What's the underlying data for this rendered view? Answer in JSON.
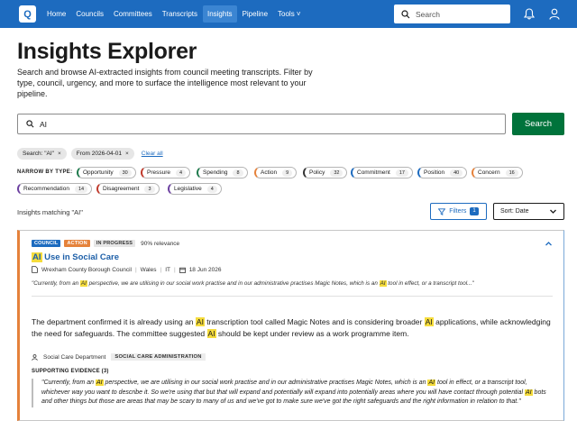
{
  "nav": {
    "logo": "Q",
    "items": [
      {
        "label": "Home"
      },
      {
        "label": "Councils"
      },
      {
        "label": "Committees"
      },
      {
        "label": "Transcripts"
      },
      {
        "label": "Insights"
      },
      {
        "label": "Pipeline"
      },
      {
        "label": "Tools ˅"
      }
    ],
    "active": "Insights",
    "search_placeholder": "Search"
  },
  "page": {
    "title": "Insights Explorer",
    "intro": "Search and browse AI-extracted insights from council meeting transcripts. Filter by type, council, urgency, and more to surface the intelligence most relevant to your pipeline."
  },
  "search": {
    "query": "AI",
    "button": "Search"
  },
  "active_filters": {
    "chips": [
      {
        "label": "Search: \"AI\"",
        "remove": "×"
      },
      {
        "label": "From 2026-04-01",
        "remove": "×"
      }
    ],
    "clear": "Clear all"
  },
  "narrow": {
    "label": "NARROW BY TYPE:",
    "types": [
      {
        "label": "Opportunity",
        "count": "30",
        "color": "#1f7a4d"
      },
      {
        "label": "Pressure",
        "count": "4",
        "color": "#c0392b"
      },
      {
        "label": "Spending",
        "count": "8",
        "color": "#1f7a4d"
      },
      {
        "label": "Action",
        "count": "9",
        "color": "#e5823b"
      },
      {
        "label": "Policy",
        "count": "32",
        "color": "#333333"
      },
      {
        "label": "Commitment",
        "count": "17",
        "color": "#1d6bbf"
      },
      {
        "label": "Position",
        "count": "40",
        "color": "#1d6bbf"
      },
      {
        "label": "Concern",
        "count": "16",
        "color": "#e5823b"
      },
      {
        "label": "Recommendation",
        "count": "14",
        "color": "#6b3fa0"
      },
      {
        "label": "Disagreement",
        "count": "3",
        "color": "#c0392b"
      },
      {
        "label": "Legislative",
        "count": "4",
        "color": "#6b3fa0"
      }
    ]
  },
  "results": {
    "heading": "Insights matching \"AI\"",
    "filters_label": "Filters",
    "filters_count": "1",
    "sort_label": "Sort: Date"
  },
  "card": {
    "badges": [
      "COUNCIL",
      "ACTION",
      "IN PROGRESS"
    ],
    "relevance": "90% relevance",
    "title_highlight": "AI",
    "title_rest": " Use in Social Care",
    "council": "Wrexham County Borough Council",
    "nation": "Wales",
    "topic": "IT",
    "date": "18 Jun 2026",
    "quote_parts": [
      "\"Currently, from an ",
      "AI",
      " perspective, we are utilising in our social work practise and in our administrative practises Magic Notes, which is an ",
      "AI",
      " tool in effect, or a transcript tool...\""
    ],
    "summary_parts": [
      "The department confirmed it is already using an ",
      "AI",
      " transcription tool called Magic Notes and is considering broader ",
      "AI",
      " applications, while acknowledging the need for safeguards. The committee suggested ",
      "AI",
      " should be kept under review as a work programme item."
    ],
    "department": "Social Care Department",
    "department_tag": "SOCIAL CARE ADMINISTRATION",
    "evidence_label": "SUPPORTING EVIDENCE (3)",
    "evidence_parts": [
      "\"Currently, from an ",
      "AI",
      " perspective, we are utilising in our social work practise and in our administrative practises Magic Notes, which is an ",
      "AI",
      " tool in effect, or a transcript tool, whichever way you want to describe it. So we're using that but that will expand and potentially will expand into potentially areas where you will have contact through potential ",
      "AI",
      " bots and other things but those are areas that may be scary to many of us and we've got to make sure we've got the right safeguards and the right information in relation to that.\""
    ]
  }
}
